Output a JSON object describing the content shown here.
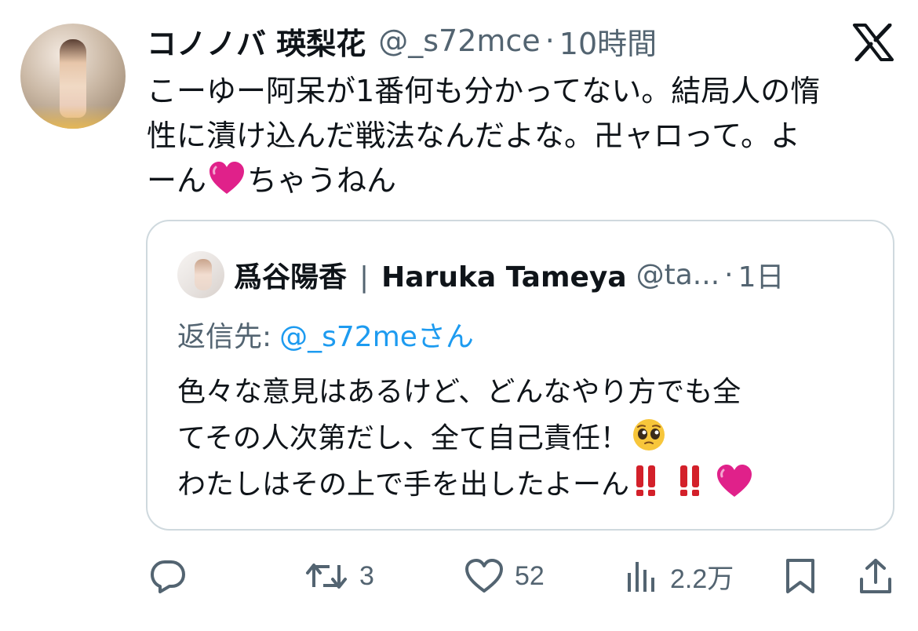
{
  "tweet": {
    "author_name": "コノノバ 瑛梨花",
    "author_handle": "@_s72mce",
    "separator": "·",
    "time": "10時間",
    "text_lines": [
      "こーゆー阿呆が1番何も分かってない。結局人の惰",
      "性に漬け込んだ戦法なんだよな。卍ャロって。よ",
      "ーん",
      "ちゃうねん"
    ]
  },
  "quote": {
    "author_name": "爲谷陽香",
    "name_divider": "|",
    "author_name_en": "Haruka Tameya",
    "author_handle": "@ta...",
    "separator": "·",
    "time": "1日",
    "reply_prefix": "返信先:",
    "reply_mention": "@_s72meさん",
    "text_lines": [
      "色々な意見はあるけど、どんなやり方でも全",
      "てその人次第だし、全て自己責任！",
      "わたしはその上で手を出したよーん"
    ]
  },
  "actions": {
    "reply_count": "",
    "retweet_count": "3",
    "like_count": "52",
    "views_count": "2.2万"
  },
  "icons": {
    "logo": "x-logo-icon",
    "reply": "reply-icon",
    "retweet": "retweet-icon",
    "like": "heart-icon",
    "views": "views-icon",
    "bookmark": "bookmark-icon",
    "share": "share-icon"
  },
  "colors": {
    "text": "#0f1419",
    "secondary": "#536471",
    "link": "#1d9bf0",
    "border": "#cfd9de",
    "heart_emoji": "#e0218a",
    "bang_emoji": "#d3202a"
  }
}
